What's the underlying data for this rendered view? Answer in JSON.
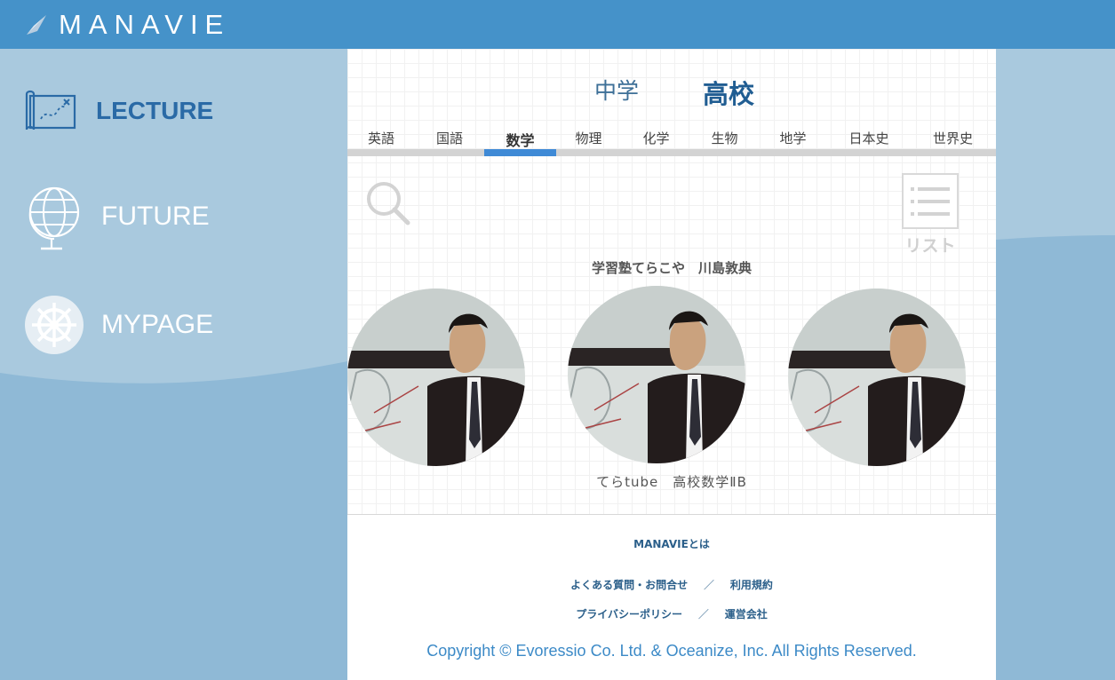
{
  "header": {
    "logo_text": "MANAVIE"
  },
  "sidebar": {
    "items": [
      {
        "label": "LECTURE",
        "icon": "map-icon",
        "active": true
      },
      {
        "label": "FUTURE",
        "icon": "globe-icon",
        "active": false
      },
      {
        "label": "MYPAGE",
        "icon": "ship-wheel-icon",
        "active": false
      }
    ]
  },
  "main": {
    "levels": {
      "junior": "中学",
      "high": "高校",
      "selected": "high"
    },
    "subjects": [
      "英語",
      "国語",
      "数学",
      "物理",
      "化学",
      "生物",
      "地学",
      "日本史",
      "世界史"
    ],
    "active_subject": "数学",
    "list_label": "リスト",
    "teacher_name": "学習塾てらこや　川島敦典",
    "video_title": "てらtube　高校数学ⅡB"
  },
  "footer": {
    "about": "MANAVIEとは",
    "faq": "よくある質問・お問合せ",
    "terms": "利用規約",
    "privacy": "プライバシーポリシー",
    "company": "運営会社",
    "separator": "／",
    "copyright": "Copyright © Evoressio Co. Ltd. & Oceanize, Inc. All Rights Reserved."
  },
  "colors": {
    "topbar": "#4592c9",
    "sidebar_bg": "#8fb9d6",
    "accent": "#3f8ad6",
    "lecture_text": "#2a6aa6"
  }
}
